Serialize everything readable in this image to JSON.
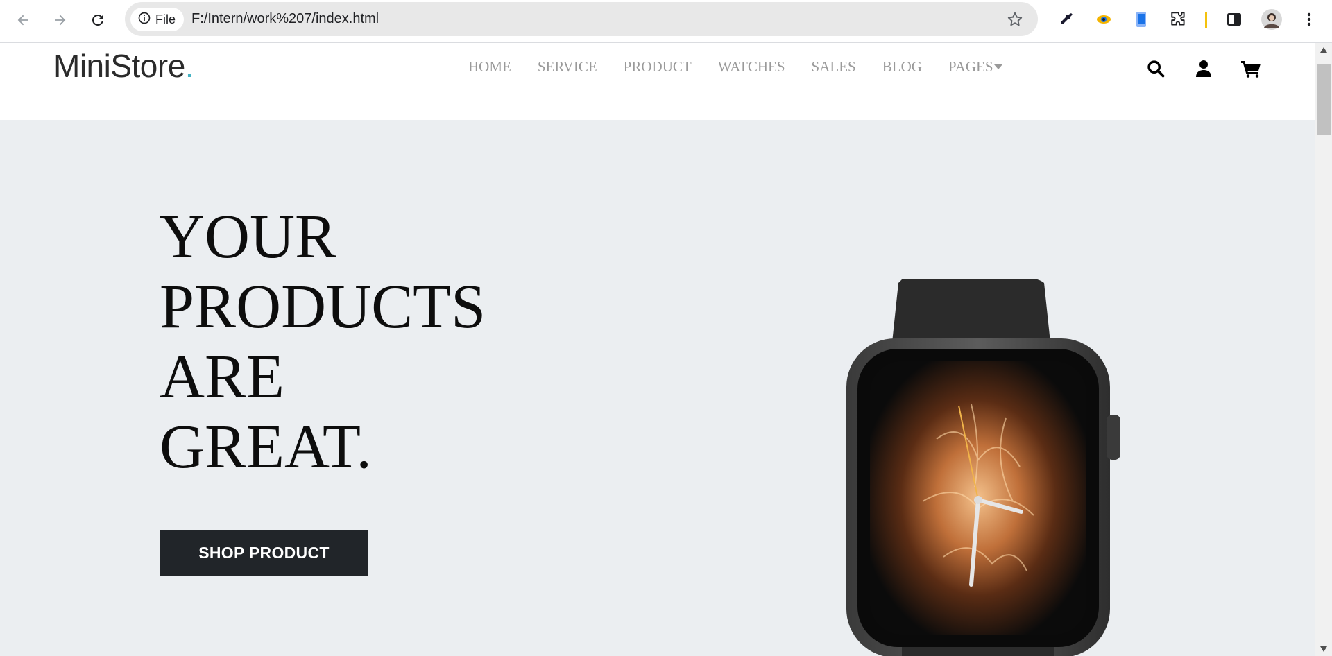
{
  "browser": {
    "chip_label": "File",
    "url": "F:/Intern/work%207/index.html"
  },
  "site": {
    "logo_text": "MiniStore",
    "logo_dot": ".",
    "nav": [
      "HOME",
      "SERVICE",
      "PRODUCT",
      "WATCHES",
      "SALES",
      "BLOG",
      "PAGES"
    ]
  },
  "hero": {
    "headline_lines": [
      "YOUR",
      "PRODUCTS",
      "ARE",
      "GREAT."
    ],
    "cta_label": "SHOP PRODUCT"
  },
  "colors": {
    "hero_bg": "#ebeef1",
    "button_bg": "#212529",
    "logo_accent": "#45b3c4",
    "nav_text": "#9a9a9a"
  },
  "icons": [
    "back-icon",
    "forward-icon",
    "reload-icon",
    "info-icon",
    "star-icon",
    "eyedropper-icon",
    "eye-extension-icon",
    "phone-extension-icon",
    "puzzle-icon",
    "sidepanel-icon",
    "avatar",
    "kebab-icon",
    "search-icon",
    "user-icon",
    "cart-icon",
    "caret-down-icon"
  ]
}
